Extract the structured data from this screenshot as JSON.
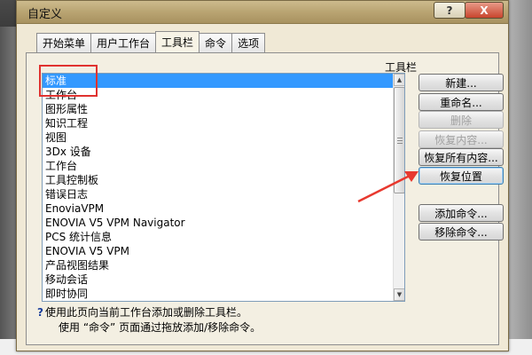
{
  "window": {
    "title": "自定义",
    "help_button": "?",
    "close_button": "X"
  },
  "tabs": [
    {
      "label": "开始菜单",
      "active": false
    },
    {
      "label": "用户工作台",
      "active": false
    },
    {
      "label": "工具栏",
      "active": true
    },
    {
      "label": "命令",
      "active": false
    },
    {
      "label": "选项",
      "active": false
    }
  ],
  "toolbars": {
    "label": "工具栏",
    "items": [
      "标准",
      "工作台",
      "图形属性",
      "知识工程",
      "视图",
      "3Dx 设备",
      "工作台",
      "工具控制板",
      "错误日志",
      "EnoviaVPM",
      "ENOVIA V5 VPM Navigator",
      "PCS 统计信息",
      "ENOVIA V5 VPM",
      "产品视图结果",
      "移动会话",
      "即时协同"
    ],
    "selected_index": 0
  },
  "buttons": {
    "new": "新建...",
    "rename": "重命名...",
    "delete": "删除",
    "restore_content": "恢复内容...",
    "restore_all": "恢复所有内容...",
    "restore_position": "恢复位置",
    "add_command": "添加命令...",
    "remove_command": "移除命令..."
  },
  "info": {
    "line1": "使用此页向当前工作台添加或删除工具栏。",
    "line2": "使用 “命令” 页面通过拖放添加/移除命令。"
  },
  "colors": {
    "selection": "#3399ff",
    "highlight_box": "#e0322f",
    "annotation_arrow": "#e8392f"
  }
}
